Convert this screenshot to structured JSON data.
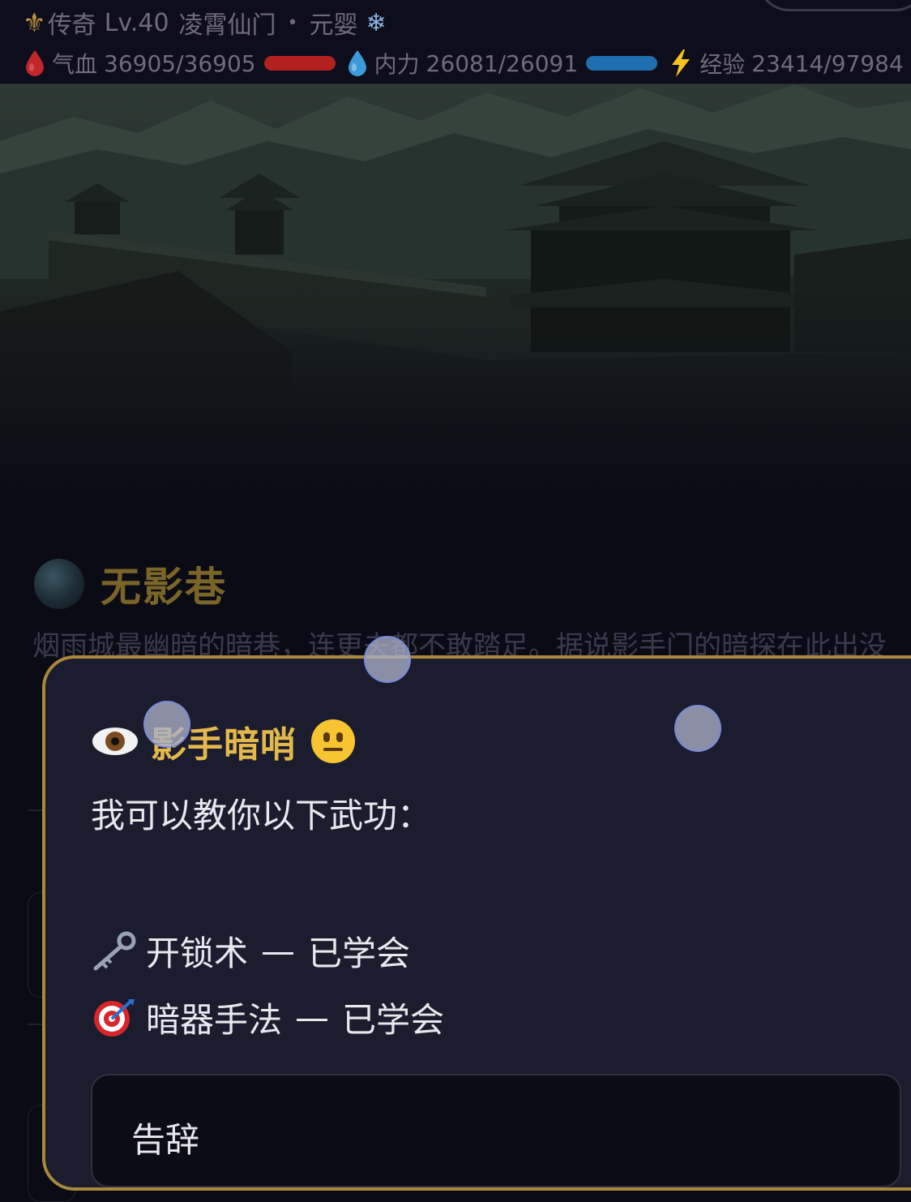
{
  "status": {
    "rank": "传奇",
    "level": "Lv.40",
    "sect": "凌霄仙门",
    "separator": "•",
    "realm": "元婴",
    "hp_label": "气血",
    "hp_value": "36905/36905",
    "hp_fraction": 1.0,
    "mp_label": "内力",
    "mp_value": "26081/26091",
    "mp_fraction": 0.9996,
    "exp_label": "经验",
    "exp_value": "23414/97984",
    "colors": {
      "hp": "#b3211f",
      "mp": "#1f6fb0",
      "exp": "#7a3aa8",
      "gold": "#e2b94a"
    },
    "icons": {
      "rank": "fleur-de-lis-icon",
      "realm": "snowflake-icon",
      "hp": "blood-drop-icon",
      "mp": "water-drop-icon",
      "exp": "lightning-icon"
    }
  },
  "location": {
    "name": "无影巷",
    "icon": "moon-icon",
    "description": "烟雨城最幽暗的暗巷，连更夫都不敢踏足。据说影手门的暗探在此出没"
  },
  "dialog": {
    "npc_name": "影手暗哨",
    "npc_icon": "eye-icon",
    "mood_icon": "neutral-face-icon",
    "intro": "我可以教你以下武功：",
    "skills": [
      {
        "name": "开锁术",
        "dash": "—",
        "state": "已学会",
        "icon": "key-icon"
      },
      {
        "name": "暗器手法",
        "dash": "—",
        "state": "已学会",
        "icon": "target-icon"
      }
    ],
    "farewell_label": "告辞"
  }
}
